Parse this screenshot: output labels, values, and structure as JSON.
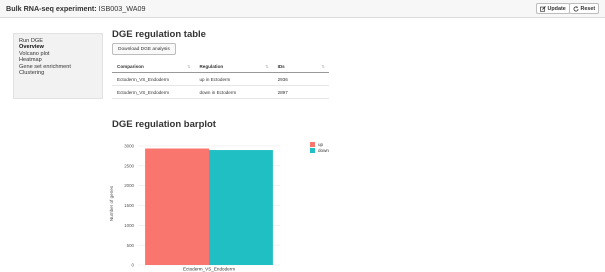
{
  "header": {
    "app_name": "Bulk RNA-seq experiment:",
    "experiment_id": "ISB003_WA09",
    "update_label": "Update",
    "reset_label": "Reset"
  },
  "sidebar": {
    "items": [
      {
        "label": "Run DGE",
        "active": false
      },
      {
        "label": "Overview",
        "active": true
      },
      {
        "label": "Volcano plot",
        "active": false
      },
      {
        "label": "Heatmap",
        "active": false
      },
      {
        "label": "Gene set enrichment",
        "active": false
      },
      {
        "label": "Clustering",
        "active": false
      }
    ]
  },
  "table_section": {
    "title": "DGE regulation table",
    "download_label": "Download DGE analysis",
    "columns": [
      "Comparison",
      "Regulation",
      "IDs"
    ],
    "rows": [
      [
        "Ectoderm_VS_Endoderm",
        "up in Ectoderm",
        "2936"
      ],
      [
        "Ectoderm_VS_Endoderm",
        "down in Ectoderm",
        "2897"
      ]
    ]
  },
  "plot_section": {
    "title": "DGE regulation barplot"
  },
  "colors": {
    "up": "#f8766d",
    "down": "#1fbfc4"
  },
  "chart_data": {
    "type": "bar",
    "categories": [
      "Ectoderm_VS_Endoderm"
    ],
    "series": [
      {
        "name": "up",
        "values": [
          2936
        ]
      },
      {
        "name": "down",
        "values": [
          2897
        ]
      }
    ],
    "title": "",
    "xlabel": "",
    "ylabel": "Number of genes",
    "ylim": [
      0,
      3100
    ],
    "yticks": [
      0,
      500,
      1000,
      1500,
      2000,
      2500,
      3000
    ],
    "grid": true,
    "legend": "top-right"
  }
}
